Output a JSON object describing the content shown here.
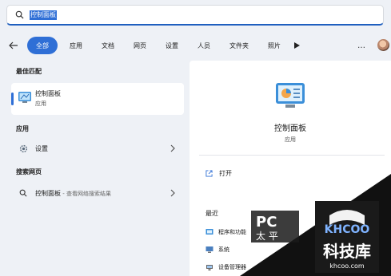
{
  "search": {
    "query": "控制面板"
  },
  "filters": {
    "chips": [
      "全部",
      "应用",
      "文档",
      "网页",
      "设置",
      "人员",
      "文件夹",
      "照片"
    ],
    "more": "…"
  },
  "left": {
    "best_match_title": "最佳匹配",
    "best_match": {
      "name": "控制面板",
      "type": "应用"
    },
    "apps_title": "应用",
    "apps": [
      {
        "name": "设置"
      }
    ],
    "web_title": "搜索网页",
    "web": [
      {
        "name": "控制面板",
        "suffix": " - 查看网络搜索结果"
      }
    ]
  },
  "detail": {
    "name": "控制面板",
    "type": "应用",
    "open_label": "打开",
    "recent_title": "最近",
    "recent": [
      "程序和功能",
      "系统",
      "设备管理器"
    ]
  },
  "watermarks": {
    "pc": "PC",
    "khcoo": "KHCOO",
    "khcoo_cn": "科技库",
    "khcoo_url": "khcoo.com"
  },
  "colors": {
    "accent": "#2f6fd6",
    "background": "#eef1f6",
    "panel": "#ffffff"
  }
}
